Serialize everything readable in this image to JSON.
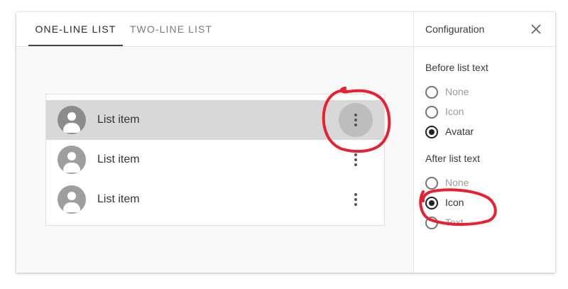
{
  "tabs": [
    {
      "label": "ONE-LINE LIST",
      "active": true
    },
    {
      "label": "TWO-LINE LIST",
      "active": false
    }
  ],
  "list": {
    "items": [
      {
        "label": "List item",
        "selected": true,
        "avatar_icon": "person-icon",
        "trailing_icon": "more-vert-icon"
      },
      {
        "label": "List item",
        "selected": false,
        "avatar_icon": "person-icon",
        "trailing_icon": "more-vert-icon"
      },
      {
        "label": "List item",
        "selected": false,
        "avatar_icon": "person-icon",
        "trailing_icon": "more-vert-icon"
      }
    ]
  },
  "config": {
    "title": "Configuration",
    "close_icon": "close-icon",
    "before": {
      "title": "Before list text",
      "options": [
        {
          "label": "None",
          "checked": false
        },
        {
          "label": "Icon",
          "checked": false
        },
        {
          "label": "Avatar",
          "checked": true
        }
      ]
    },
    "after": {
      "title": "After list text",
      "options": [
        {
          "label": "None",
          "checked": false
        },
        {
          "label": "Icon",
          "checked": true
        },
        {
          "label": "Text",
          "checked": false
        }
      ]
    }
  },
  "colors": {
    "annotation": "#e8202f",
    "selected_row": "#d8d8d8",
    "avatar": "#9e9e9e"
  }
}
